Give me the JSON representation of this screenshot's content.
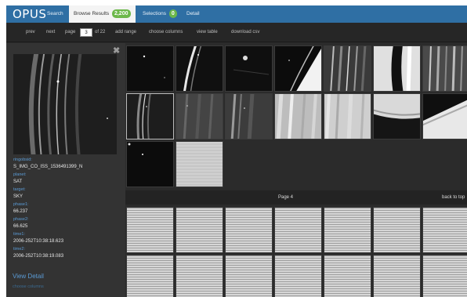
{
  "brand": "OPUS",
  "tabs": [
    {
      "label": "Search"
    },
    {
      "label": "Browse Results",
      "badge": "2,200"
    },
    {
      "label": "Selections",
      "badge": "0"
    },
    {
      "label": "Detail"
    }
  ],
  "toolbar": {
    "prev": "prev",
    "next": "next",
    "page_label": "page",
    "page_value": "3",
    "of_pages": "of 22",
    "add_range": "add range",
    "choose_columns": "choose columns",
    "view_table": "view table",
    "download_csv": "download csv"
  },
  "detail": {
    "fields": [
      {
        "label": "ringobsid:",
        "value": "S_IMG_CO_ISS_1536491399_N"
      },
      {
        "label": "planet:",
        "value": "SAT"
      },
      {
        "label": "target:",
        "value": "SKY"
      },
      {
        "label": "phase1:",
        "value": "66.237"
      },
      {
        "label": "phase2:",
        "value": "66.625"
      },
      {
        "label": "time1:",
        "value": "2006-252T10:38:18.623"
      },
      {
        "label": "time2:",
        "value": "2006-252T10:38:19.083"
      }
    ],
    "view_detail": "View Detail",
    "choose_columns": "choose columns"
  },
  "gallery": {
    "page_label": "Page 4",
    "back_to_top": "back to top"
  },
  "colors": {
    "topbar": "#2f6fa4",
    "link": "#5b9bd5",
    "badge": "#6cb84a",
    "panel": "#333333"
  }
}
